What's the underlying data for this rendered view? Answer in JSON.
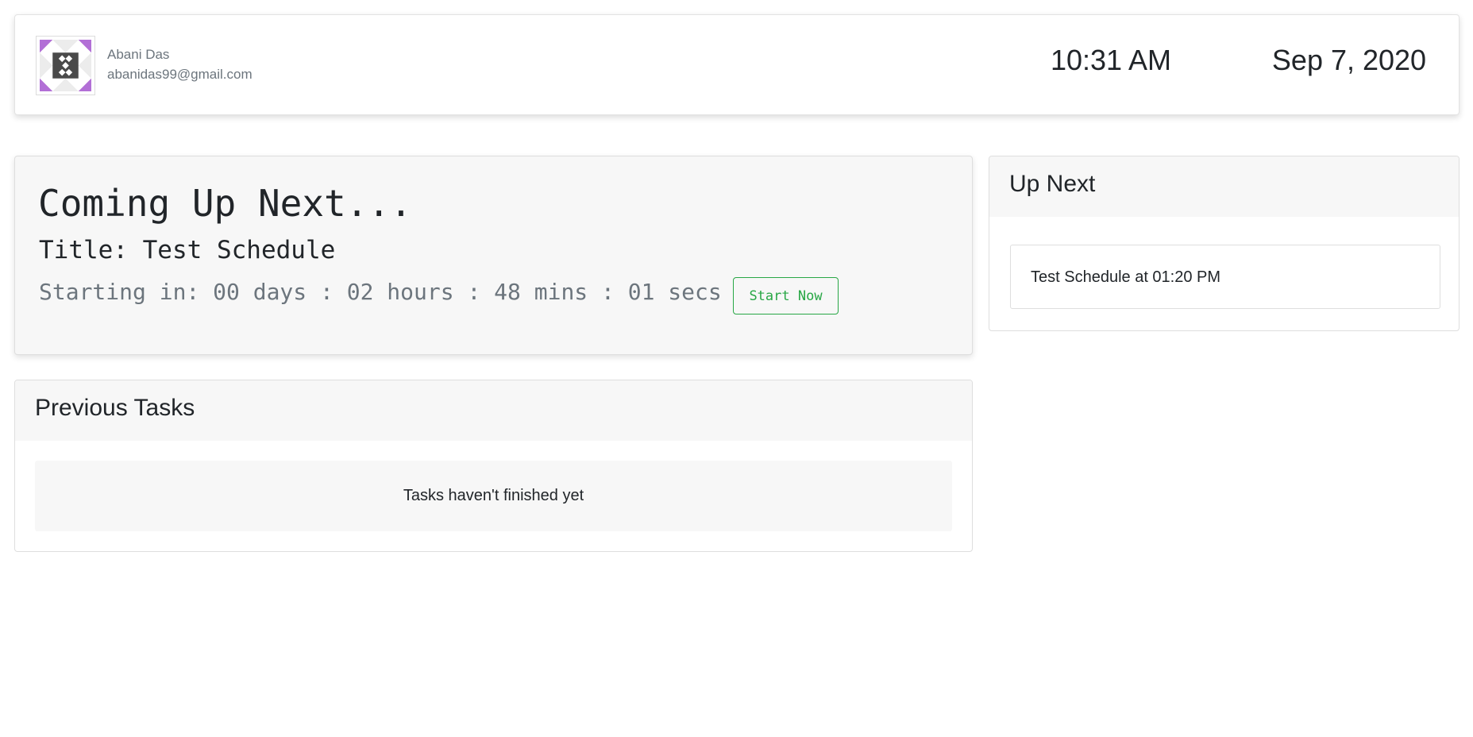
{
  "user": {
    "name": "Abani Das",
    "email": "abanidas99@gmail.com",
    "avatar_icon": "identicon-avatar"
  },
  "clock": {
    "time": "10:31 AM",
    "date": "Sep 7, 2020"
  },
  "countdown": {
    "heading": "Coming Up Next...",
    "title": "Title: Test Schedule",
    "timer": "Starting in: 00 days : 02 hours : 48 mins : 01 secs",
    "start_button": "Start Now"
  },
  "previous_tasks": {
    "header": "Previous Tasks",
    "empty_message": "Tasks haven't finished yet"
  },
  "up_next": {
    "header": "Up Next",
    "items": [
      {
        "label": "Test Schedule at 01:20 PM"
      }
    ]
  },
  "colors": {
    "accent_green": "#28a745",
    "muted_text": "#6c757d",
    "card_header_bg": "#f7f7f7",
    "avatar_purple": "#b26fd6",
    "avatar_dark": "#4a4a4a"
  }
}
